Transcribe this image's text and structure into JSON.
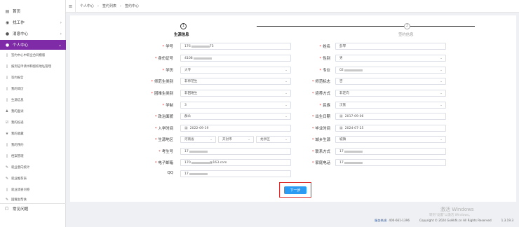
{
  "sidebar": {
    "home": "首页",
    "work": "找工作",
    "messages": "消息中心",
    "personal_center": "个人中心",
    "sub_items": [
      {
        "label": "签约中心中职业合同模版",
        "icon": "doc-icon"
      },
      {
        "label": "报到证申请书和留校地址管理",
        "icon": "doc-icon"
      },
      {
        "label": "签约报告",
        "icon": "doc-icon"
      },
      {
        "label": "我的简历",
        "icon": "doc-icon"
      },
      {
        "label": "生源信息",
        "icon": "doc-icon"
      },
      {
        "label": "我的面试",
        "icon": "users-icon"
      },
      {
        "label": "我的投递",
        "icon": "check-icon"
      },
      {
        "label": "我的收藏",
        "icon": "star-icon"
      },
      {
        "label": "我的预约",
        "icon": "doc-icon"
      },
      {
        "label": "档案管理",
        "icon": "doc-icon"
      },
      {
        "label": "就业意向统计",
        "icon": "pen-icon"
      },
      {
        "label": "就业推荐表",
        "icon": "pen-icon"
      },
      {
        "label": "就业调查问卷",
        "icon": "doc-icon"
      },
      {
        "label": "困难生帮扶",
        "icon": "pen-icon"
      }
    ],
    "bottom": "常见问题"
  },
  "breadcrumb": [
    "个人中心",
    "签约列表",
    "签约中心"
  ],
  "steps": [
    {
      "num": "1",
      "label": "生源信息"
    },
    {
      "num": "2",
      "label": "签约信息"
    }
  ],
  "form": {
    "student_id": {
      "label": "学号",
      "value": "176",
      "tail": "75"
    },
    "name": {
      "label": "姓名",
      "value": "彭琴"
    },
    "id_number": {
      "label": "身份证号",
      "value": "4108"
    },
    "gender": {
      "label": "性别",
      "value": "男"
    },
    "education": {
      "label": "学历",
      "value": "大专"
    },
    "major": {
      "label": "专业",
      "value": "02"
    },
    "normal_category": {
      "label": "师范生类别",
      "value": "非师范生"
    },
    "normal_status": {
      "label": "师范标志",
      "value": "否"
    },
    "difficulty_category": {
      "label": "困难生类别",
      "value": "非困难生"
    },
    "training_mode": {
      "label": "培养方式",
      "value": "非定向"
    },
    "years": {
      "label": "学制",
      "value": "3"
    },
    "ethnicity": {
      "label": "民族",
      "value": "汉族"
    },
    "political": {
      "label": "政治面貌",
      "value": "群众"
    },
    "birth_date": {
      "label": "出生日期",
      "value": "2017-09-06"
    },
    "enroll_date": {
      "label": "入学时间",
      "value": "2022-09-19"
    },
    "grad_date": {
      "label": "毕业时间",
      "value": "2024-07-25"
    },
    "origin": {
      "label": "生源地区",
      "province": "河南省",
      "city": "开封市",
      "district": "龙亭区"
    },
    "urban_rural": {
      "label": "城乡生源",
      "value": "城镇"
    },
    "exam_number": {
      "label": "考生号",
      "value": "17"
    },
    "contact_phone": {
      "label": "联系方式",
      "value": "17"
    },
    "email": {
      "label": "电子邮箱",
      "value": "170",
      "tail": "@163.com"
    },
    "home_phone": {
      "label": "家庭电话",
      "value": "17"
    },
    "qq": {
      "label": "QQ",
      "value": "17"
    }
  },
  "next_button": "下一步",
  "footer": {
    "hotline_label": "服务热线:",
    "hotline": "400-661-1396",
    "copyright": "Copyright © 2024 GxHkfk.cn All Rights Reserved",
    "version": "1.3.19.3"
  },
  "watermark": {
    "line1": "激活 Windows",
    "line2": "转到“设置”以激活 Windows。"
  },
  "colors": {
    "sidebar_active": "#7f2aa6",
    "primary_button": "#2e9bf2",
    "highlight_border": "#d9302f",
    "required": "#e4393c"
  }
}
